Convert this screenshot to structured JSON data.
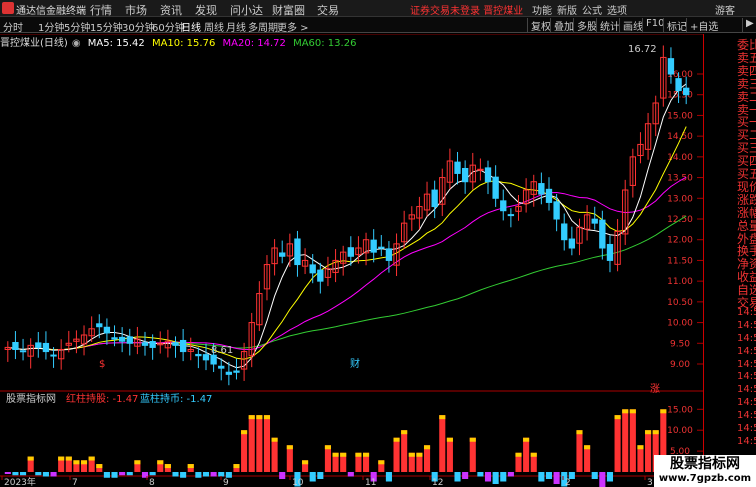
{
  "app": {
    "title": "通达信金融终端"
  },
  "menu": [
    "行情",
    "市场",
    "资讯",
    "发现",
    "问小达",
    "财富圈",
    "交易"
  ],
  "warning": "证券交易未登录",
  "stock_name_top": "晋控煤业",
  "right_menu": [
    "功能",
    "新版",
    "公式",
    "选项",
    "游客"
  ],
  "periods": [
    "分时",
    "1分钟",
    "5分钟",
    "15分钟",
    "30分钟",
    "60分钟",
    "日线",
    "周线",
    "月线",
    "多周期",
    "更多 >"
  ],
  "toolbar": [
    "复权",
    "叠加",
    "多股",
    "统计",
    "画线",
    "F10",
    "标记",
    "+自选",
    "▶"
  ],
  "ma_line": {
    "name": "晋控煤业(日线)",
    "ma5_label": "MA5: 15.42",
    "ma10_label": "MA10: 15.76",
    "ma20_label": "MA20: 14.72",
    "ma60_label": "MA60: 13.26"
  },
  "indicator_line": {
    "name": "股票指标网",
    "red_label": "红柱持股: -1.47",
    "blue_label": "蓝柱持币: -1.47"
  },
  "right_panel": [
    "委比",
    "卖五",
    "卖四",
    "卖三",
    "卖二",
    "卖一",
    "买一",
    "买二",
    "买三",
    "买四",
    "买五",
    "现价",
    "涨跌",
    "涨幅",
    "总量",
    "外盘",
    "换手",
    "净资",
    "收益",
    "自选",
    "交易",
    "14:50",
    "14:50",
    "14:50",
    "14:50",
    "14:50",
    "14:50",
    "14:50",
    "14:50",
    "14:50",
    "14:50",
    "14:50"
  ],
  "price_ticks": [
    "16.00",
    "15.50",
    "15.00",
    "14.50",
    "14.00",
    "13.50",
    "13.00",
    "12.50",
    "12.00",
    "11.50",
    "11.00",
    "10.50",
    "10.00",
    "9.50",
    "9.00"
  ],
  "ind_ticks": [
    "15.00",
    "10.00",
    "5.00",
    "0.00"
  ],
  "x_labels": [
    "2023年",
    "7",
    "8",
    "9",
    "10",
    "11",
    "12",
    "2",
    "3"
  ],
  "annotations": {
    "high": "16.72",
    "low": "8.61",
    "mark1": "$",
    "mark2": "财",
    "mark3": "涨"
  },
  "watermark": {
    "line1": "股票指标网",
    "line2": "www.7gpzb.com"
  },
  "colors": {
    "up": "#ff3333",
    "down": "#33ccff",
    "ma5": "#ffffff",
    "ma10": "#ffff00",
    "ma20": "#ff00ff",
    "ma60": "#33cc33"
  },
  "chart_data": {
    "type": "candlestick",
    "closes": [
      9.4,
      9.35,
      9.3,
      9.45,
      9.4,
      9.3,
      9.2,
      9.35,
      9.5,
      9.6,
      9.7,
      9.85,
      9.9,
      9.75,
      9.6,
      9.55,
      9.5,
      9.6,
      9.45,
      9.4,
      9.5,
      9.55,
      9.45,
      9.3,
      9.35,
      9.2,
      9.1,
      9.0,
      8.9,
      8.75,
      8.8,
      9.3,
      10.0,
      10.7,
      11.4,
      11.8,
      11.6,
      11.9,
      11.4,
      11.5,
      11.2,
      11.0,
      11.3,
      11.5,
      11.7,
      11.6,
      11.8,
      12.0,
      11.7,
      11.8,
      11.5,
      11.9,
      12.4,
      12.6,
      12.8,
      13.1,
      12.8,
      13.5,
      13.9,
      13.6,
      13.4,
      13.8,
      13.7,
      13.4,
      13.0,
      12.7,
      12.6,
      12.8,
      13.2,
      13.4,
      13.1,
      12.9,
      12.5,
      12.0,
      11.8,
      12.3,
      12.6,
      12.4,
      11.8,
      11.5,
      12.2,
      13.2,
      14.0,
      14.3,
      14.8,
      15.3,
      16.4,
      16.0,
      15.6,
      15.5
    ]
  }
}
